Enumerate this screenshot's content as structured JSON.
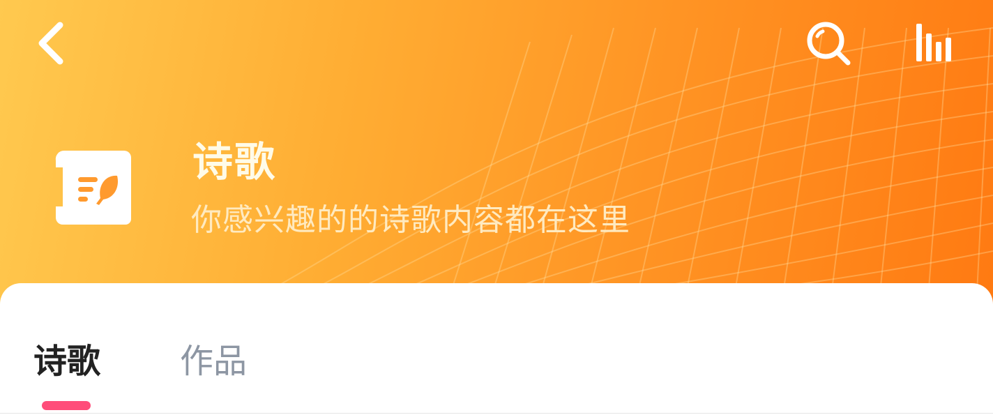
{
  "header": {
    "title": "诗歌",
    "subtitle": "你感兴趣的的诗歌内容都在这里"
  },
  "toolbar": {
    "back_icon": "chevron-left-icon",
    "search_icon": "search-icon",
    "chart_icon": "bar-chart-icon"
  },
  "tabs": [
    {
      "label": "诗歌",
      "active": true
    },
    {
      "label": "作品",
      "active": false
    }
  ],
  "colors": {
    "header_gradient_start": "#ffc94f",
    "header_gradient_end": "#ff7a12",
    "active_tab_indicator": "#ff4d7a",
    "inactive_tab_text": "#8d96a3"
  }
}
